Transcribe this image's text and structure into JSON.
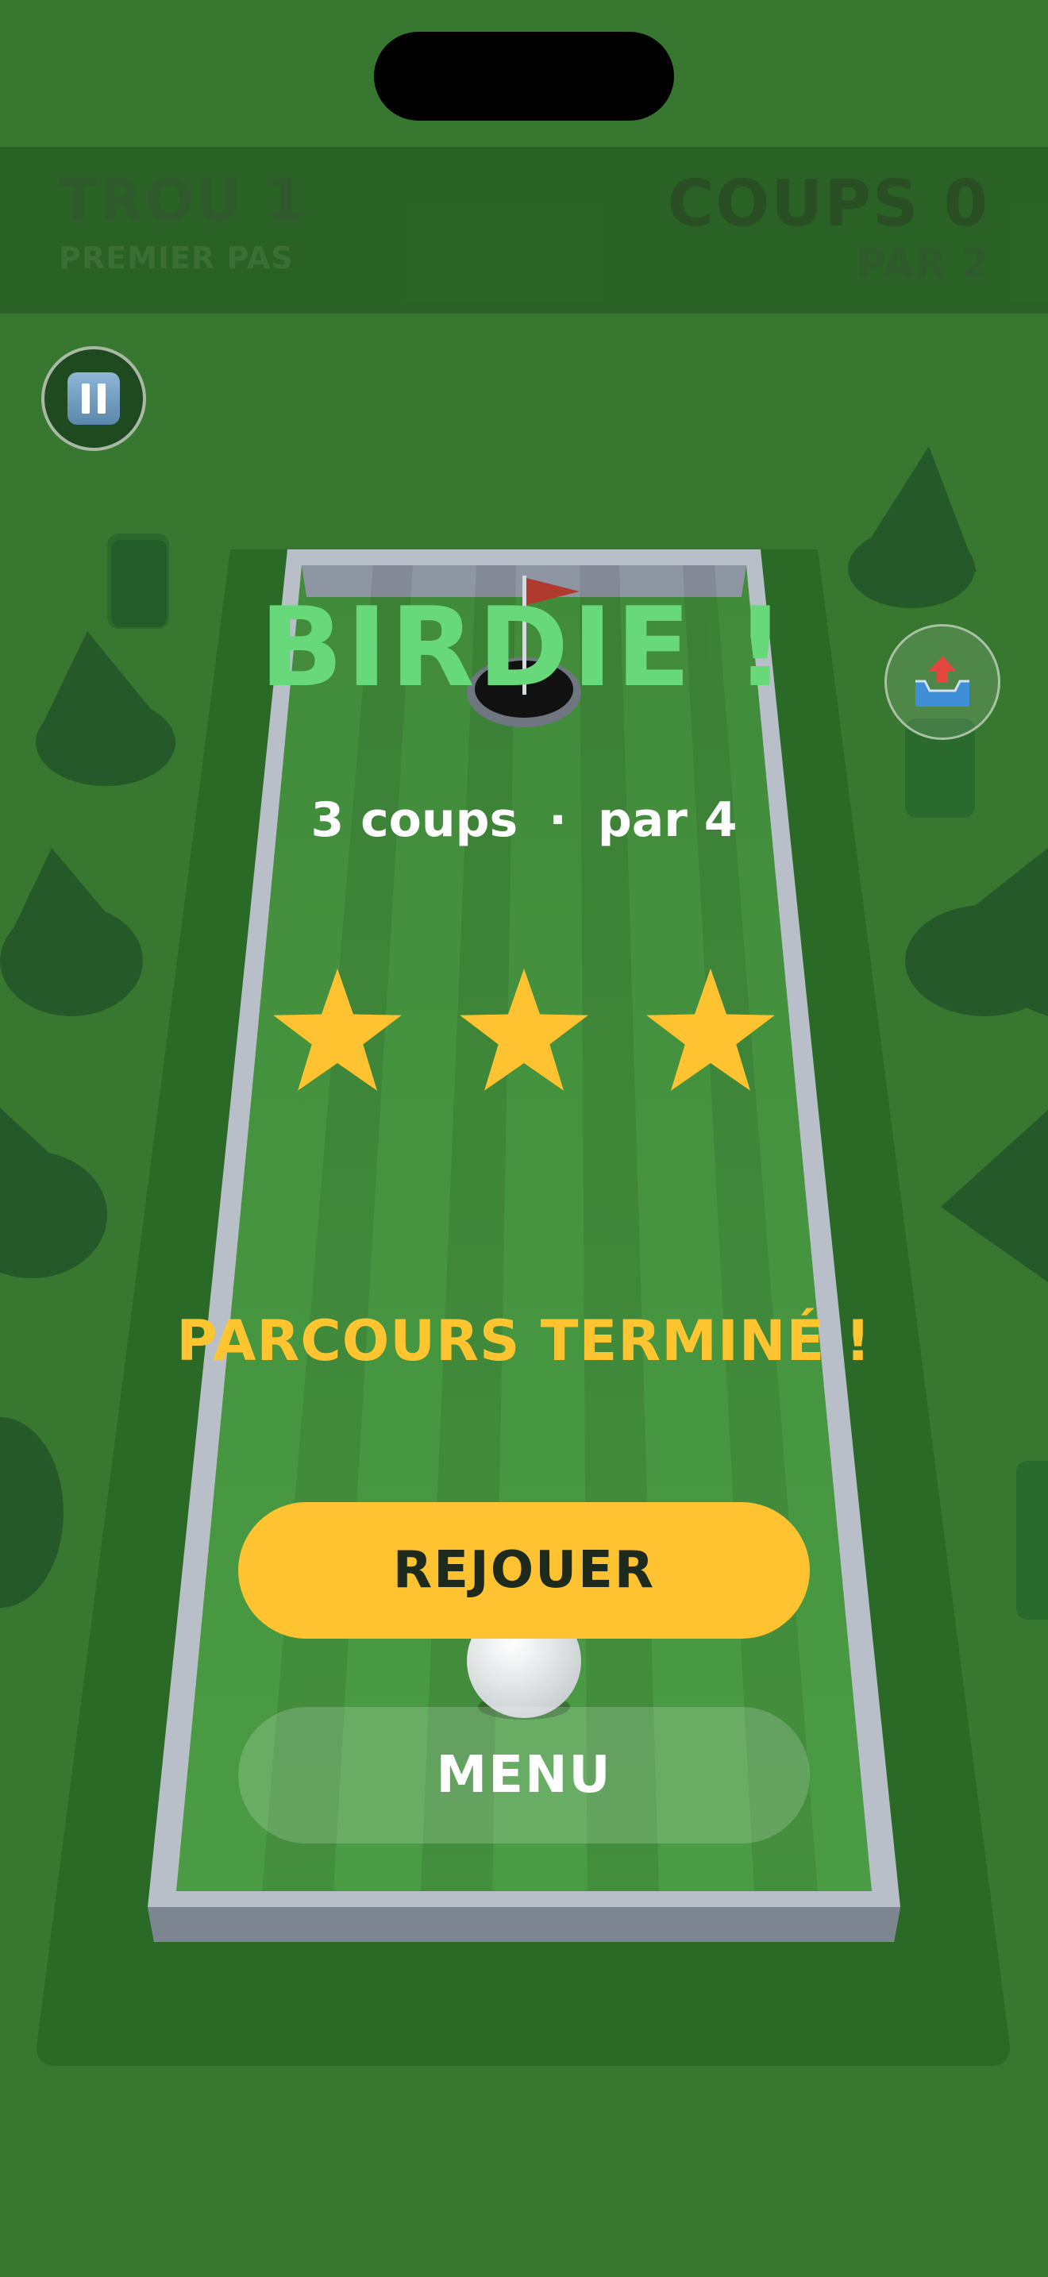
{
  "hud": {
    "hole_label": "TROU 1",
    "hole_name": "PREMIER PAS",
    "strokes_label": "COUPS 0",
    "par_label": "PAR 2"
  },
  "result": {
    "title": "BIRDIE !",
    "strokes_text": "3 coups",
    "separator": "·",
    "par_text": "par 4",
    "stars_earned": 3,
    "stars_total": 3
  },
  "course_complete": "PARCOURS TERMINÉ !",
  "buttons": {
    "replay": "REJOUER",
    "menu": "MENU"
  },
  "icons": {
    "pause": "pause-icon",
    "share": "share-icon"
  },
  "colors": {
    "birdie": "#67d97a",
    "star": "#ffc331",
    "complete": "#ffc531",
    "replay_button": "#ffc331"
  }
}
